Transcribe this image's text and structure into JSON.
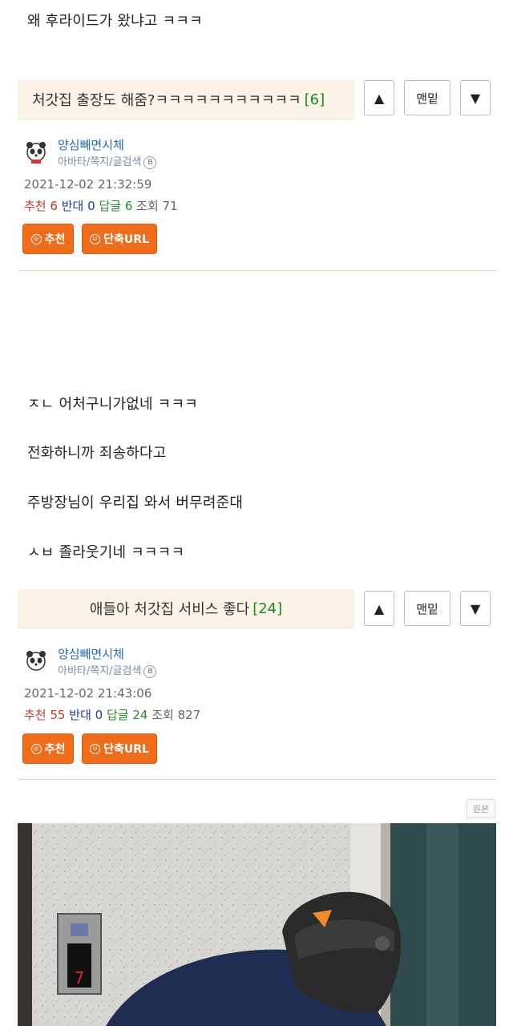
{
  "post_top": {
    "line": "왜 후라이드가 왔냐고 ㅋㅋㅋ"
  },
  "reply1": {
    "title": "처갓집 출장도 해줌?ㅋㅋㅋㅋㅋㅋㅋㅋㅋㅋㅋ",
    "count": "[6]",
    "nav": {
      "up": "▲",
      "bottom": "맨밑",
      "down": "▼"
    },
    "nickname": "양심빼면시체",
    "sublinks": "아바타/쪽지/글검색",
    "badge": "B",
    "date": "2021-12-02 21:32:59",
    "stats": {
      "rec_label": "추천",
      "rec": "6",
      "opp_label": "반대",
      "opp": "0",
      "rep_label": "답글",
      "rep": "6",
      "view_label": "조회",
      "view": "71"
    },
    "btn_recommend": "추천",
    "btn_url": "단축URL",
    "icon_recommend": "◎",
    "icon_url": "U"
  },
  "body_lines": [
    "ㅈㄴ 어처구니가없네 ㅋㅋㅋ",
    "전화하니까 죄송하다고",
    "주방장님이 우리집 와서 버무려준대",
    "ㅅㅂ 졸라웃기네 ㅋㅋㅋㅋ"
  ],
  "reply2": {
    "title": "애들아 처갓집 서비스 좋다",
    "count": "[24]",
    "nav": {
      "up": "▲",
      "bottom": "맨밑",
      "down": "▼"
    },
    "nickname": "양심빼면시체",
    "sublinks": "아바타/쪽지/글검색",
    "badge": "B",
    "date": "2021-12-02 21:43:06",
    "stats": {
      "rec_label": "추천",
      "rec": "55",
      "opp_label": "반대",
      "opp": "0",
      "rep_label": "답글",
      "rep": "24",
      "view_label": "조회",
      "view": "827"
    },
    "btn_recommend": "추천",
    "btn_url": "단축URL",
    "icon_recommend": "◎",
    "icon_url": "U"
  },
  "original_badge": "원본",
  "photo": {
    "elevator_digit": "7"
  }
}
